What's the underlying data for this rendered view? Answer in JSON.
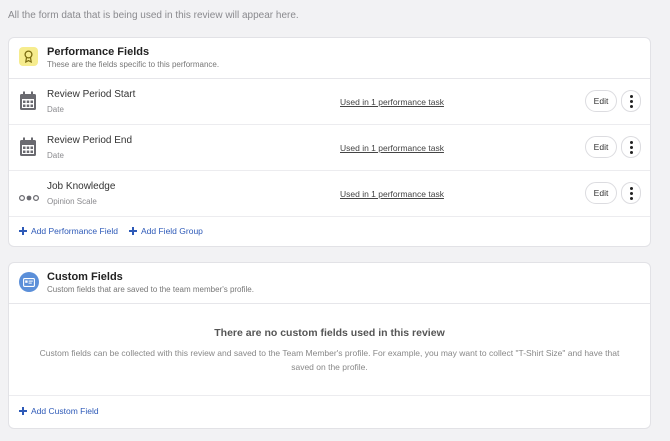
{
  "intro_text": "All the form data that is being used in this review will appear here.",
  "performance": {
    "title": "Performance Fields",
    "subtitle": "These are the fields specific to this performance.",
    "fields": [
      {
        "name": "Review Period Start",
        "type": "Date",
        "usage": "Used in 1 performance task",
        "icon": "calendar-icon"
      },
      {
        "name": "Review Period End",
        "type": "Date",
        "usage": "Used in 1 performance task",
        "icon": "calendar-icon"
      },
      {
        "name": "Job Knowledge",
        "type": "Opinion Scale",
        "usage": "Used in 1 performance task",
        "icon": "opinion-scale-icon"
      }
    ],
    "edit_label": "Edit",
    "add_field_label": "Add Performance Field",
    "add_group_label": "Add Field Group"
  },
  "custom": {
    "title": "Custom Fields",
    "subtitle": "Custom fields that are saved to the team member's profile.",
    "empty_title": "There are no custom fields used in this review",
    "empty_text": "Custom fields can be collected with this review and saved to the Team Member's profile. For example, you may want to collect \"T-Shirt Size\" and have that saved on the profile.",
    "add_label": "Add Custom Field"
  },
  "colors": {
    "accent": "#2e5ab8",
    "perf_icon_bg": "#f6ec8e",
    "custom_icon_bg": "#5b8fd9"
  }
}
